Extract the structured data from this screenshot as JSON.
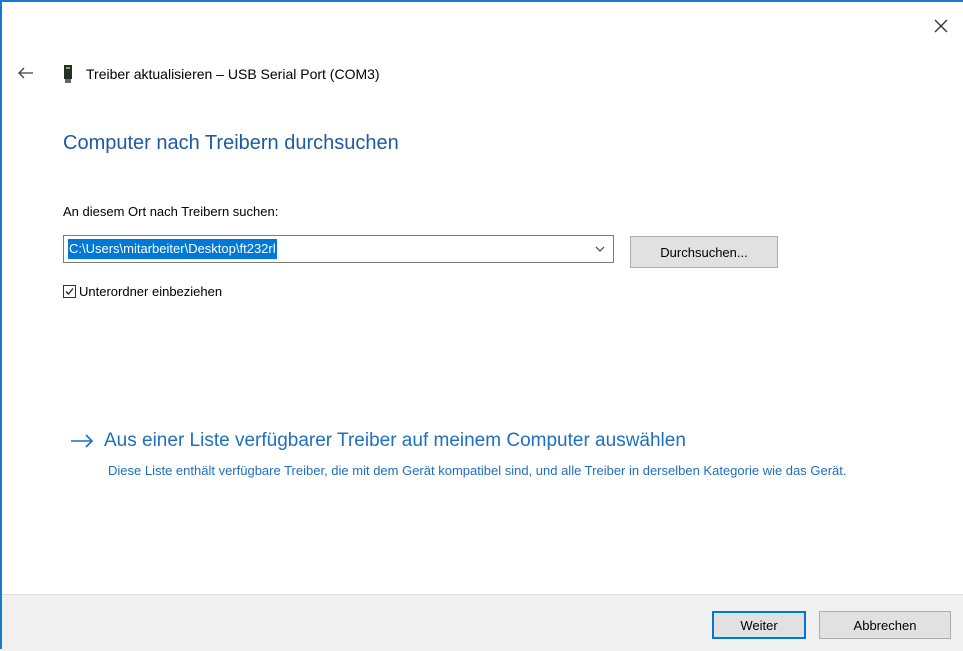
{
  "dialog": {
    "title": "Treiber aktualisieren – USB Serial Port (COM3)",
    "heading": "Computer nach Treibern durchsuchen",
    "search_label": "An diesem Ort nach Treibern suchen:",
    "path_value": "C:\\Users\\mitarbeiter\\Desktop\\ft232rl",
    "browse_label": "Durchsuchen...",
    "include_subfolders_label": "Unterordner einbeziehen",
    "include_subfolders_checked": true,
    "list_link_label": "Aus einer Liste verfügbarer Treiber auf meinem Computer auswählen",
    "list_link_description": "Diese Liste enthält verfügbare Treiber, die mit dem Gerät kompatibel sind, und alle Treiber in derselben Kategorie wie das Gerät."
  },
  "footer": {
    "next_label": "Weiter",
    "cancel_label": "Abbrechen"
  },
  "icons": {
    "close": "close-icon",
    "back": "back-arrow-icon",
    "device": "usb-device-icon",
    "combo": "chevron-down-icon",
    "checkbox": "checkmark-icon",
    "link": "arrow-right-icon"
  },
  "colors": {
    "accent": "#1979ca",
    "heading": "#1e5aa0",
    "link": "#1e6fc0",
    "selection": "#0078d7"
  }
}
